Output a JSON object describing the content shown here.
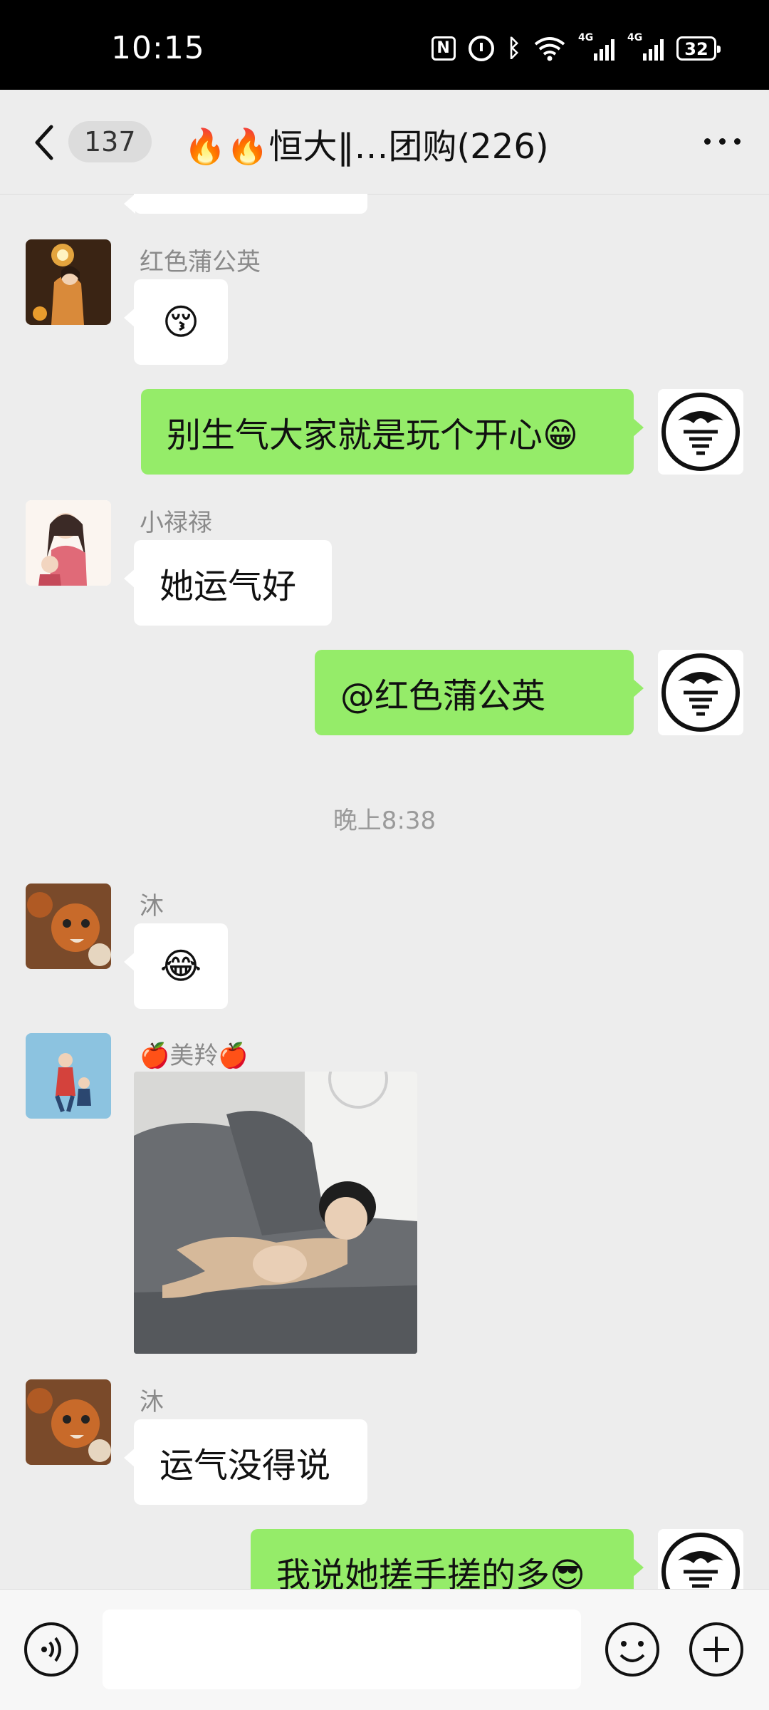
{
  "status_bar": {
    "time": "10:15",
    "signal1_label": "4G",
    "signal2_label": "4G",
    "battery": "32"
  },
  "header": {
    "unread_count": "137",
    "title": "🔥🔥恒大‖…团购(226)"
  },
  "messages": [
    {
      "side": "left",
      "sender": "红色蒲公英",
      "type": "emoji",
      "emoji": "😚"
    },
    {
      "side": "right",
      "type": "text",
      "text": "别生气大家就是玩个开心😁"
    },
    {
      "side": "left",
      "sender": "小禄禄",
      "type": "text",
      "text": "她运气好"
    },
    {
      "side": "right",
      "type": "text",
      "text": "@红色蒲公英"
    },
    {
      "type": "timestamp",
      "text": "晚上8:38"
    },
    {
      "side": "left",
      "sender": "沐",
      "type": "emoji",
      "emoji": "😂"
    },
    {
      "side": "left",
      "sender": "🍎美羚🍎",
      "type": "image"
    },
    {
      "side": "left",
      "sender": "沐",
      "type": "text",
      "text": "运气没得说"
    },
    {
      "side": "right",
      "type": "text",
      "text": "我说她搓手搓的多😎"
    }
  ],
  "colors": {
    "own_bubble": "#95ec69",
    "other_bubble": "#ffffff",
    "background": "#ededed"
  },
  "icons": {
    "back": "chevron-left-icon",
    "more": "more-dots-icon",
    "voice": "voice-icon",
    "emoji": "emoji-icon",
    "plus": "plus-icon"
  }
}
